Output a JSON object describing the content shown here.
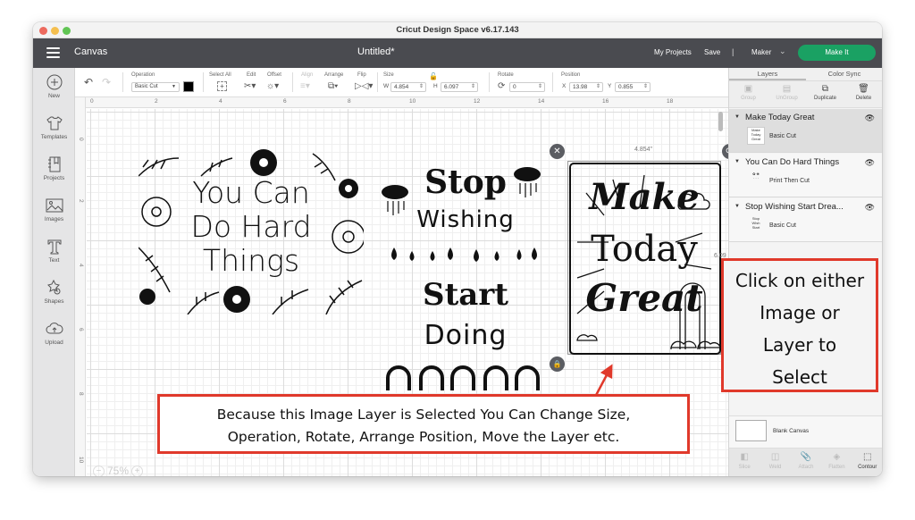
{
  "window": {
    "title": "Cricut Design Space  v6.17.143"
  },
  "header": {
    "menu_icon": "hamburger-menu-icon",
    "section": "Canvas",
    "document_title": "Untitled*",
    "my_projects": "My Projects",
    "save": "Save",
    "separator": "|",
    "machine": "Maker",
    "make_it": "Make It",
    "accent_color": "#1aa163"
  },
  "sidebar": {
    "items": [
      {
        "label": "New",
        "icon": "plus-circle-icon"
      },
      {
        "label": "Templates",
        "icon": "tshirt-icon"
      },
      {
        "label": "Projects",
        "icon": "notebook-icon"
      },
      {
        "label": "Images",
        "icon": "image-icon"
      },
      {
        "label": "Text",
        "icon": "text-t-icon"
      },
      {
        "label": "Shapes",
        "icon": "shapes-icon"
      },
      {
        "label": "Upload",
        "icon": "cloud-upload-icon"
      }
    ]
  },
  "toolbar": {
    "undo_icon": "undo-icon",
    "redo_icon": "redo-icon",
    "operation_label": "Operation",
    "operation_value": "Basic Cut",
    "operation_color": "#000000",
    "select_all": "Select All",
    "edit": "Edit",
    "offset": "Offset",
    "align": "Align",
    "arrange": "Arrange",
    "flip": "Flip",
    "size_label": "Size",
    "width_label": "W",
    "width_value": "4.854",
    "height_label": "H",
    "height_value": "6.097",
    "rotate_label": "Rotate",
    "rotate_value": "0",
    "position_label": "Position",
    "x_label": "X",
    "x_value": "13.98",
    "y_label": "Y",
    "y_value": "0.855"
  },
  "canvas": {
    "ruler_top": [
      "0",
      "2",
      "4",
      "6",
      "8",
      "10",
      "12",
      "14",
      "16",
      "18"
    ],
    "ruler_left": [
      "0",
      "2",
      "4",
      "6",
      "8",
      "10"
    ],
    "zoom_level": "75%",
    "selection_width": "4.854\"",
    "selection_height": "6.09",
    "artworks": [
      {
        "name": "you-can-do-hard-things",
        "lines": [
          "You  Can",
          "Do Hard",
          "Things"
        ]
      },
      {
        "name": "stop-wishing-start-doing",
        "lines": [
          "Stop",
          "Wishing",
          "Start",
          "Doing"
        ]
      },
      {
        "name": "make-today-great",
        "lines": [
          "Make",
          "Today",
          "Great"
        ]
      }
    ]
  },
  "annotations": {
    "bottom_callout": [
      "Because this Image Layer is Selected You Can Change Size,",
      "Operation, Rotate, Arrange Position,  Move the Layer etc."
    ],
    "right_callout": [
      "Click on either",
      "Image or",
      "Layer to",
      "Select"
    ],
    "callout_color": "#e0392b"
  },
  "panel": {
    "tabs": [
      {
        "label": "Layers",
        "active": true
      },
      {
        "label": "Color Sync",
        "active": false
      }
    ],
    "tools": [
      {
        "label": "Group",
        "enabled": false
      },
      {
        "label": "UnGroup",
        "enabled": false
      },
      {
        "label": "Duplicate",
        "enabled": true
      },
      {
        "label": "Delete",
        "enabled": true
      }
    ],
    "layers": [
      {
        "name": "Make Today Great",
        "operation": "Basic Cut",
        "selected": true,
        "visible": true
      },
      {
        "name": "You Can Do Hard Things",
        "operation": "Print Then Cut",
        "selected": false,
        "visible": true
      },
      {
        "name": "Stop Wishing Start Drea...",
        "operation": "Basic Cut",
        "selected": false,
        "visible": true
      }
    ],
    "blank_canvas": "Blank Canvas",
    "bottom_tools": [
      {
        "label": "Slice",
        "enabled": false
      },
      {
        "label": "Weld",
        "enabled": false
      },
      {
        "label": "Attach",
        "enabled": false
      },
      {
        "label": "Flatten",
        "enabled": false
      },
      {
        "label": "Contour",
        "enabled": true
      }
    ]
  }
}
